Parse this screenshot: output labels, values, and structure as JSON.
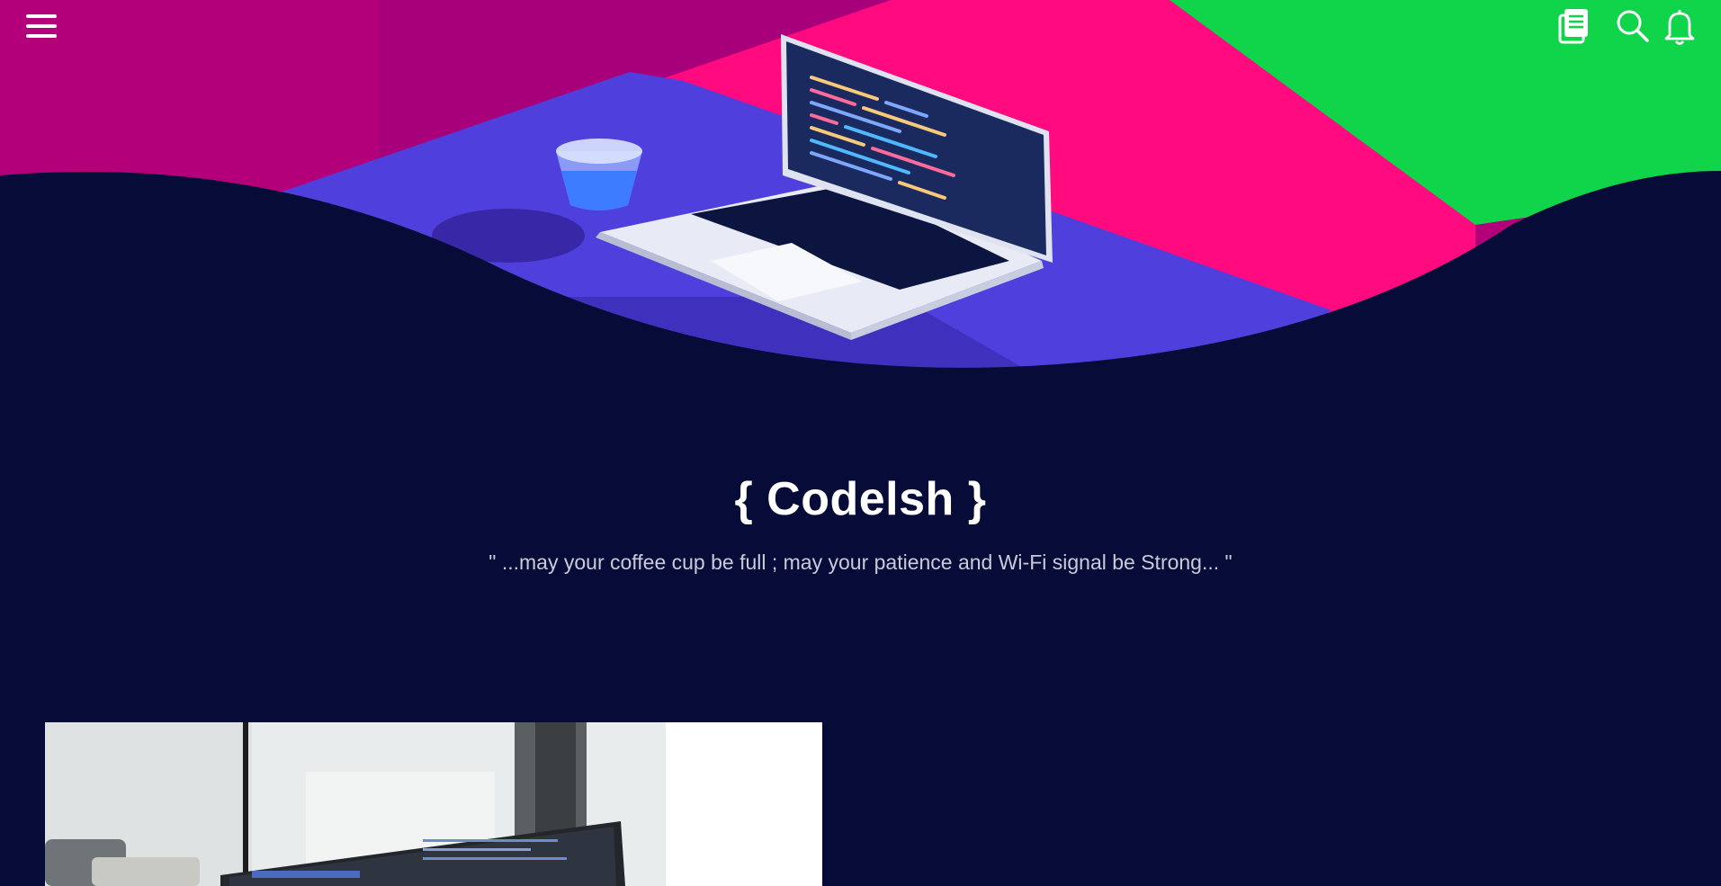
{
  "header": {
    "menu_icon": "hamburger-menu-icon",
    "icons": [
      "books-icon",
      "search-icon",
      "bell-icon"
    ]
  },
  "hero": {
    "brand": "{ Codelsh }",
    "tagline": "\" ...may your coffee cup be full ; may your patience and Wi-Fi signal be Strong... \""
  },
  "colors": {
    "background": "#070b38",
    "magenta": "#b3007a",
    "pink": "#ff0a7f",
    "green": "#10d44a",
    "desk": "#4f3fdc",
    "text": "#ffffff",
    "muted_text": "#c9cbd8"
  }
}
